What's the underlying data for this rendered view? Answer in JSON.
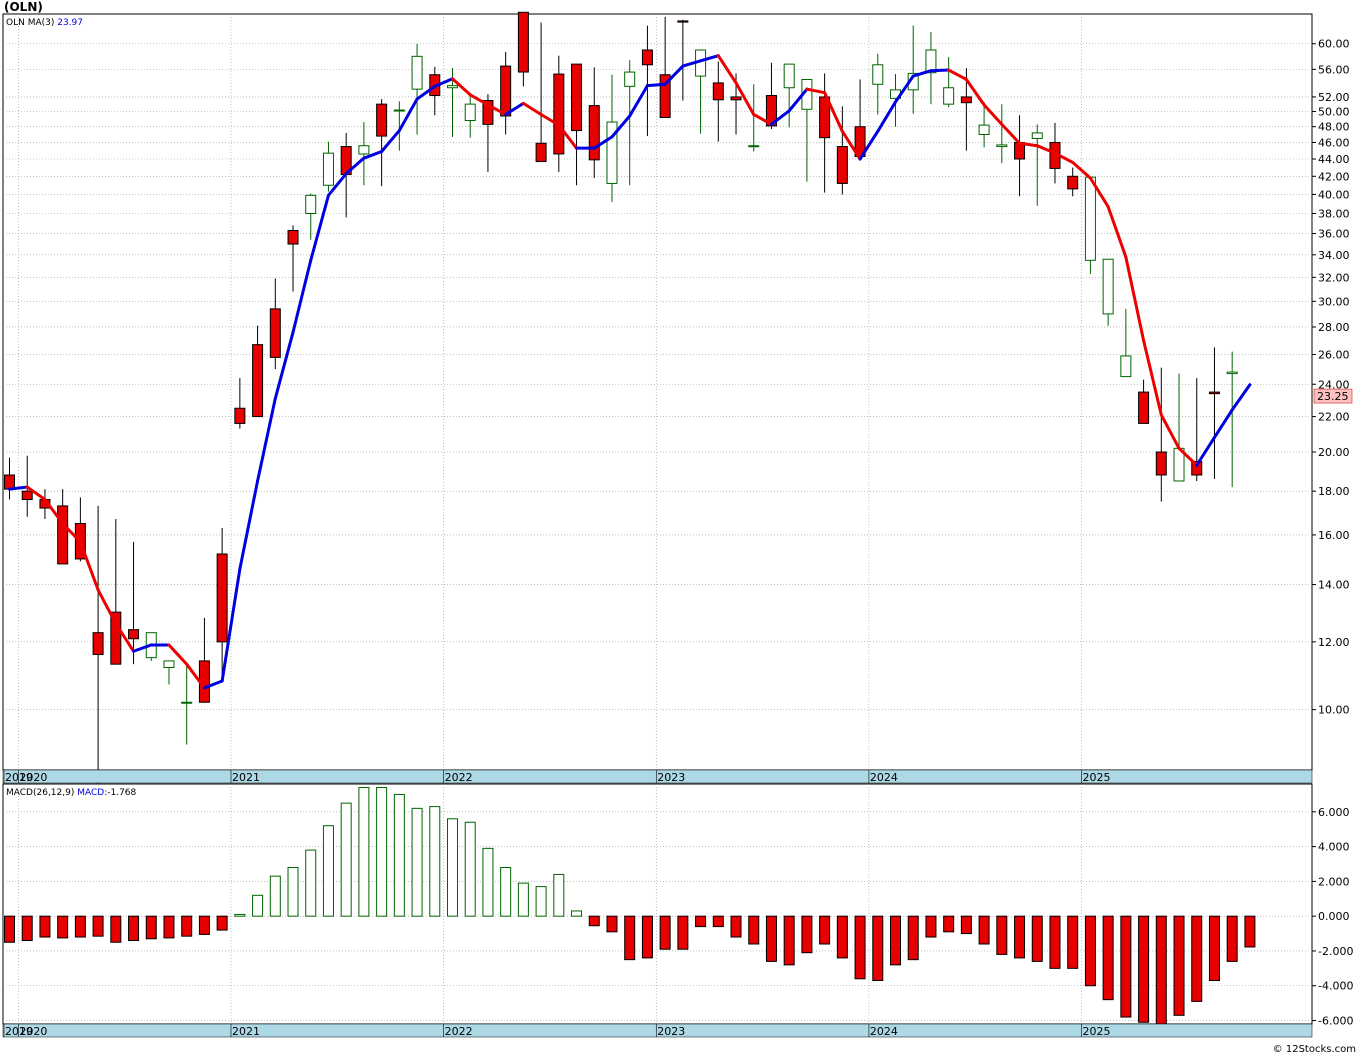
{
  "title": "(OLN)",
  "credit": "© 12Stocks.com",
  "price_panel": {
    "ticker": "OLN",
    "ma_label": "MA(3)",
    "ma_value": "23.97",
    "last_price": "23.25",
    "y_ticks": [
      "10.00",
      "12.00",
      "14.00",
      "16.00",
      "18.00",
      "20.00",
      "22.00",
      "24.00",
      "26.00",
      "28.00",
      "30.00",
      "32.00",
      "34.00",
      "36.00",
      "38.00",
      "40.00",
      "42.00",
      "44.00",
      "46.00",
      "48.00",
      "50.00",
      "52.00",
      "56.00",
      "60.00"
    ],
    "x_ticks": [
      "2019",
      "2020",
      "2021",
      "2022",
      "2023",
      "2024",
      "2025"
    ]
  },
  "macd_panel": {
    "label": "MACD(26,12,9)",
    "macd_label": "MACD:",
    "macd_value": "-1.768",
    "y_ticks": [
      "6.000",
      "4.000",
      "2.000",
      "0.000",
      "-2.000",
      "-4.000",
      "-6.000"
    ],
    "x_ticks": [
      "2019",
      "2020",
      "2021",
      "2022",
      "2023",
      "2024",
      "2025"
    ]
  },
  "colors": {
    "up_fill": "#ffffff",
    "up_stroke": "#006400",
    "down_fill": "#e60000",
    "down_stroke": "#000000",
    "ma_up": "#0000e0",
    "ma_down": "#ee0000",
    "axis_band": "#add8e6",
    "grid": "#999999",
    "price_tag": "#ffc0c0"
  },
  "chart_data": [
    {
      "type": "candlestick",
      "interval": "monthly",
      "scale": "log",
      "ylim": [
        8.5,
        65
      ],
      "x": [
        "2019-12",
        "2020-01",
        "2020-02",
        "2020-03",
        "2020-04",
        "2020-05",
        "2020-06",
        "2020-07",
        "2020-08",
        "2020-09",
        "2020-10",
        "2020-11",
        "2020-12",
        "2021-01",
        "2021-02",
        "2021-03",
        "2021-04",
        "2021-05",
        "2021-06",
        "2021-07",
        "2021-08",
        "2021-09",
        "2021-10",
        "2021-11",
        "2021-12",
        "2022-01",
        "2022-02",
        "2022-03",
        "2022-04",
        "2022-05",
        "2022-06",
        "2022-07",
        "2022-08",
        "2022-09",
        "2022-10",
        "2022-11",
        "2022-12",
        "2023-01",
        "2023-02",
        "2023-03",
        "2023-04",
        "2023-05",
        "2023-06",
        "2023-07",
        "2023-08",
        "2023-09",
        "2023-10",
        "2023-11",
        "2023-12",
        "2024-01",
        "2024-02",
        "2024-03",
        "2024-04",
        "2024-05",
        "2024-06",
        "2024-07",
        "2024-08",
        "2024-09",
        "2024-10",
        "2024-11",
        "2024-12",
        "2025-01",
        "2025-02",
        "2025-03",
        "2025-04",
        "2025-05",
        "2025-06",
        "2025-07",
        "2025-08",
        "2025-09"
      ],
      "open": [
        18.8,
        18.0,
        17.6,
        17.3,
        16.5,
        12.3,
        13.0,
        12.4,
        11.5,
        11.2,
        10.2,
        11.4,
        15.2,
        22.5,
        26.7,
        29.4,
        36.3,
        38.0,
        41.0,
        45.5,
        44.6,
        51.0,
        50.2,
        53.1,
        55.2,
        53.3,
        48.8,
        51.5,
        56.5,
        65.3,
        45.9,
        55.3,
        56.8,
        50.8,
        41.2,
        53.5,
        59.0,
        55.2,
        63.8,
        55.0,
        54.0,
        52.0,
        45.5,
        52.2,
        53.3,
        50.3,
        52.0,
        45.5,
        48.0,
        53.8,
        51.8,
        53.0,
        55.5,
        51.0,
        52.0,
        47.0,
        45.5,
        46.0,
        46.5,
        46.0,
        42.0,
        33.5,
        29.0,
        24.5,
        23.5,
        20.0,
        18.5,
        19.5,
        23.5,
        24.7
      ],
      "high": [
        19.7,
        19.8,
        18.1,
        18.1,
        17.7,
        17.3,
        16.7,
        15.7,
        12.3,
        11.3,
        11.3,
        12.8,
        16.3,
        24.4,
        28.1,
        31.9,
        36.8,
        40.1,
        46.1,
        47.2,
        48.6,
        51.7,
        51.4,
        60.0,
        56.4,
        56.2,
        52.4,
        52.4,
        58.7,
        64.8,
        63.5,
        58.1,
        56.8,
        56.3,
        55.2,
        57.4,
        63.0,
        64.5,
        64.0,
        58.4,
        57.2,
        55.4,
        53.8,
        57.0,
        54.1,
        54.2,
        55.4,
        50.7,
        54.5,
        58.4,
        55.3,
        63.0,
        61.9,
        57.9,
        56.2,
        51.3,
        51.0,
        49.5,
        48.3,
        48.5,
        43.0,
        34.9,
        30.2,
        29.4,
        24.3,
        25.1,
        24.7,
        24.4,
        26.5,
        26.2
      ],
      "low": [
        17.6,
        16.8,
        16.7,
        16.0,
        14.9,
        8.2,
        11.6,
        11.3,
        11.4,
        10.7,
        9.1,
        10.2,
        10.9,
        21.3,
        22.4,
        25.0,
        30.8,
        35.4,
        40.3,
        37.6,
        41.0,
        40.9,
        45.0,
        47.0,
        49.5,
        46.7,
        46.6,
        42.5,
        47.0,
        53.5,
        43.7,
        42.5,
        41.0,
        41.8,
        39.2,
        41.0,
        46.8,
        50.8,
        51.5,
        47.1,
        46.1,
        47.0,
        44.9,
        47.7,
        47.9,
        41.4,
        40.2,
        40.0,
        45.4,
        49.6,
        48.0,
        49.7,
        51.0,
        50.6,
        45.0,
        45.4,
        43.5,
        39.8,
        38.8,
        41.2,
        39.8,
        32.3,
        28.1,
        24.5,
        21.6,
        17.5,
        18.9,
        18.5,
        18.6,
        18.2
      ],
      "close": [
        18.1,
        17.6,
        17.2,
        14.8,
        15.0,
        11.6,
        11.3,
        12.1,
        12.3,
        11.4,
        10.2,
        10.2,
        12.0,
        21.6,
        22.0,
        25.8,
        35.0,
        39.9,
        44.7,
        42.2,
        45.6,
        46.8,
        50.2,
        58.0,
        52.2,
        53.6,
        51.0,
        48.3,
        49.4,
        55.6,
        43.7,
        44.6,
        47.5,
        43.9,
        48.6,
        55.6,
        56.7,
        49.2,
        63.6,
        59.0,
        51.6,
        51.6,
        45.6,
        48.1,
        56.8,
        54.5,
        46.6,
        41.2,
        44.3,
        56.7,
        53.0,
        55.4,
        59.0,
        53.3,
        51.2,
        48.2,
        45.7,
        44.0,
        47.2,
        42.9,
        40.6,
        41.9,
        33.6,
        25.9,
        21.6,
        18.8,
        20.2,
        18.8,
        23.4,
        24.8,
        23.3
      ]
    },
    {
      "type": "line",
      "name": "MA(3)",
      "scale": "log",
      "x_ref": "price",
      "values": [
        18.1,
        18.2,
        17.6,
        16.5,
        15.7,
        13.8,
        12.6,
        11.7,
        11.9,
        11.9,
        11.3,
        10.6,
        10.8,
        14.6,
        18.5,
        23.1,
        27.6,
        33.5,
        39.9,
        42.3,
        44.1,
        44.9,
        47.5,
        51.7,
        53.5,
        54.6,
        52.3,
        50.9,
        49.6,
        51.1,
        49.6,
        48.2,
        45.3,
        45.3,
        46.7,
        49.4,
        53.6,
        53.8,
        56.5,
        57.3,
        58.1,
        54.0,
        49.6,
        48.3,
        50.1,
        53.1,
        52.6,
        47.4,
        44.0,
        47.4,
        51.3,
        55.0,
        55.8,
        55.9,
        54.5,
        50.9,
        48.3,
        45.9,
        45.6,
        44.7,
        43.6,
        41.8,
        38.7,
        33.8,
        27.0,
        22.1,
        20.2,
        19.3,
        20.8,
        22.4,
        23.97
      ]
    },
    {
      "type": "bar",
      "name": "MACD(26,12,9)",
      "ylim": [
        -6.2,
        7.6
      ],
      "x_ref": "price",
      "values": [
        -1.5,
        -1.4,
        -1.2,
        -1.25,
        -1.2,
        -1.15,
        -1.5,
        -1.4,
        -1.3,
        -1.25,
        -1.15,
        -1.05,
        -0.8,
        0.1,
        1.2,
        2.3,
        2.8,
        3.8,
        5.2,
        6.5,
        7.4,
        7.4,
        7.0,
        6.2,
        6.3,
        5.6,
        5.4,
        3.9,
        2.8,
        1.9,
        1.7,
        2.4,
        0.3,
        -0.55,
        -0.9,
        -2.5,
        -2.4,
        -1.9,
        -1.9,
        -0.6,
        -0.6,
        -1.2,
        -1.6,
        -2.6,
        -2.8,
        -2.1,
        -1.6,
        -2.4,
        -3.6,
        -3.7,
        -2.8,
        -2.5,
        -1.2,
        -0.9,
        -1.0,
        -1.6,
        -2.2,
        -2.4,
        -2.6,
        -3.0,
        -3.0,
        -4.0,
        -4.8,
        -5.8,
        -6.1,
        -6.2,
        -5.7,
        -4.9,
        -3.7,
        -2.6,
        -1.77
      ]
    }
  ]
}
